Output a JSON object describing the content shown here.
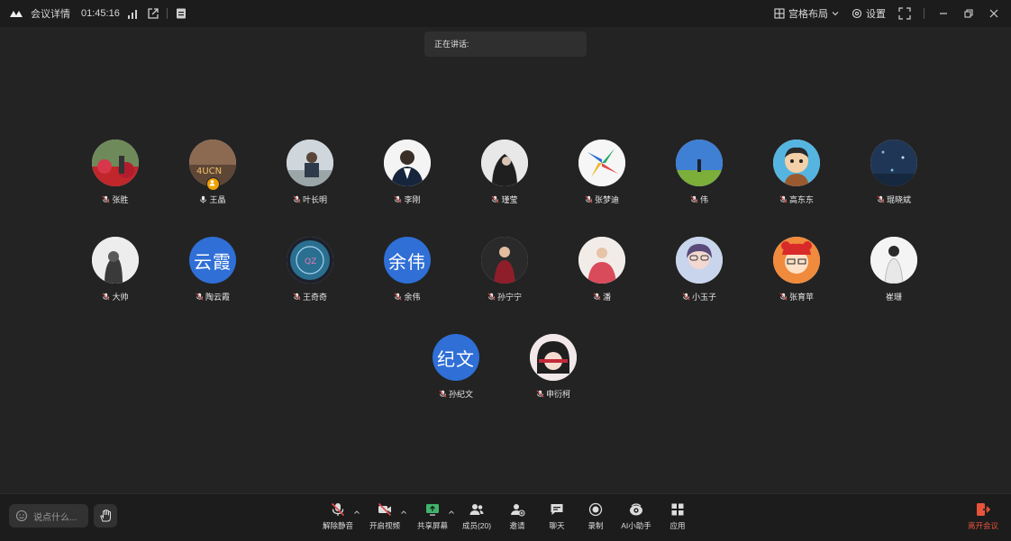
{
  "app": {
    "meeting_details": "会议详情",
    "elapsed": "01:45:16",
    "layout_label": "宫格布局",
    "settings_label": "设置"
  },
  "speaking_banner": "正在讲话:",
  "participants": [
    {
      "name": "张胜",
      "mic": "muted"
    },
    {
      "name": "王晶",
      "mic": "host"
    },
    {
      "name": "叶长明",
      "mic": "muted"
    },
    {
      "name": "李刚",
      "mic": "muted"
    },
    {
      "name": "瑾莹",
      "mic": "muted"
    },
    {
      "name": "张梦迪",
      "mic": "muted"
    },
    {
      "name": "伟",
      "mic": "muted"
    },
    {
      "name": "高东东",
      "mic": "muted"
    },
    {
      "name": "琨晓斌",
      "mic": "muted"
    },
    {
      "name": "大帅",
      "mic": "muted"
    },
    {
      "name": "陶云霞",
      "mic": "muted",
      "avatar_text": "云霞"
    },
    {
      "name": "王奇奇",
      "mic": "muted"
    },
    {
      "name": "余伟",
      "mic": "muted",
      "avatar_text": "余伟"
    },
    {
      "name": "孙宁宁",
      "mic": "muted"
    },
    {
      "name": "潘",
      "mic": "muted"
    },
    {
      "name": "小玉子",
      "mic": "muted"
    },
    {
      "name": "张育苹",
      "mic": "muted"
    },
    {
      "name": "崔珊",
      "mic": "none"
    },
    {
      "name": "孙纪文",
      "mic": "muted",
      "avatar_text": "纪文"
    },
    {
      "name": "申衍柯",
      "mic": "muted"
    }
  ],
  "bottombar": {
    "chat_placeholder": "说点什么...",
    "controls": [
      {
        "label": "解除静音",
        "icon": "mic-muted-icon",
        "caret": true
      },
      {
        "label": "开启视频",
        "icon": "video-off-icon",
        "caret": true
      },
      {
        "label": "共享屏幕",
        "icon": "share-screen-icon",
        "caret": true
      },
      {
        "label": "成员(20)",
        "icon": "members-icon",
        "caret": false
      },
      {
        "label": "邀请",
        "icon": "invite-icon",
        "caret": false
      },
      {
        "label": "聊天",
        "icon": "chat-icon",
        "caret": false
      },
      {
        "label": "录制",
        "icon": "record-icon",
        "caret": false
      },
      {
        "label": "AI小助手",
        "icon": "ai-assistant-icon",
        "caret": false
      },
      {
        "label": "应用",
        "icon": "apps-icon",
        "caret": false
      }
    ],
    "leave_label": "离开会议"
  },
  "colors": {
    "background": "#232323",
    "bar": "#1c1c1c",
    "avatar_blue": "#2f6fd6",
    "leave_red": "#e8533a",
    "muted_red": "#e04b4b",
    "host_orange": "#f0a100"
  }
}
